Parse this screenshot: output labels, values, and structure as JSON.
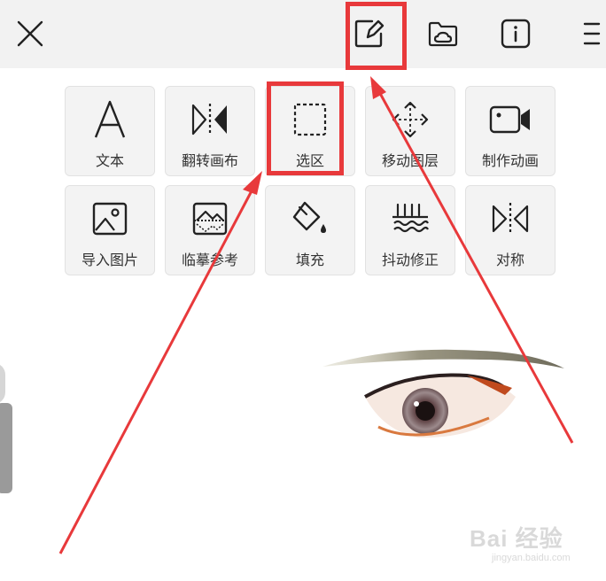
{
  "toolbar": {
    "close_icon": "close-icon",
    "buttons": [
      "edit-layer-icon",
      "cloud-folder-icon",
      "info-icon",
      "menu-icon"
    ]
  },
  "tools": [
    {
      "label": "文本",
      "icon": "text-icon"
    },
    {
      "label": "翻转画布",
      "icon": "flip-canvas-icon"
    },
    {
      "label": "选区",
      "icon": "selection-icon"
    },
    {
      "label": "移动图层",
      "icon": "move-layer-icon"
    },
    {
      "label": "制作动画",
      "icon": "animation-icon"
    },
    {
      "label": "导入图片",
      "icon": "image-import-icon"
    },
    {
      "label": "临摹参考",
      "icon": "trace-reference-icon"
    },
    {
      "label": "填充",
      "icon": "fill-bucket-icon"
    },
    {
      "label": "抖动修正",
      "icon": "stabilizer-icon"
    },
    {
      "label": "对称",
      "icon": "symmetry-icon"
    }
  ],
  "watermark": {
    "text": "Bai 经验",
    "sub": "jingyan.baidu.com"
  },
  "colors": {
    "highlight": "#e8393b",
    "toolbar_bg": "#f2f2f2",
    "tile_bg": "#f3f3f3"
  }
}
